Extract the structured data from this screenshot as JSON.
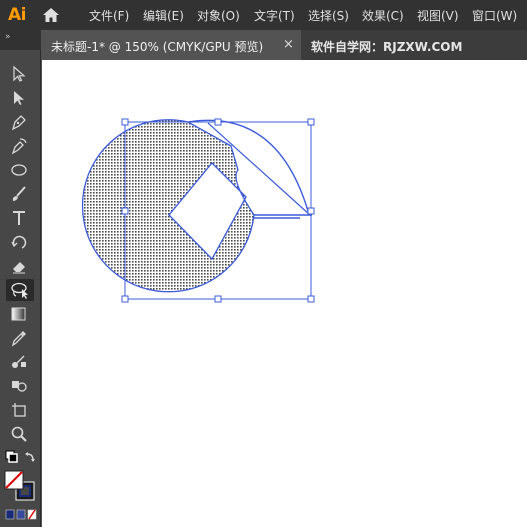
{
  "app": {
    "logo": "Ai"
  },
  "menu": [
    {
      "id": "file",
      "label": "文件(F)"
    },
    {
      "id": "edit",
      "label": "编辑(E)"
    },
    {
      "id": "object",
      "label": "对象(O)"
    },
    {
      "id": "type",
      "label": "文字(T)"
    },
    {
      "id": "select",
      "label": "选择(S)"
    },
    {
      "id": "effect",
      "label": "效果(C)"
    },
    {
      "id": "view",
      "label": "视图(V)"
    },
    {
      "id": "window",
      "label": "窗口(W)"
    }
  ],
  "tabs": {
    "active_title": "未标题-1* @ 150% (CMYK/GPU 预览)",
    "close_symbol": "×",
    "inactive_title": "软件自学网：RJZXW.COM"
  },
  "toolbar": {
    "collapse": "»",
    "tools": [
      "selection-tool",
      "direct-selection-tool",
      "pen-tool",
      "curvature-tool",
      "ellipse-tool",
      "paintbrush-tool",
      "type-tool",
      "rotate-tool",
      "eraser-tool",
      "lasso-tool",
      "gradient-tool",
      "eyedropper-tool",
      "blend-tool",
      "shape-builder-tool",
      "artboard-tool",
      "zoom-tool"
    ],
    "active_tool": "lasso-tool"
  },
  "colors": {
    "selection": "#3b5bdb",
    "fill_pattern": "#4a4a4a",
    "menubar": "#323232",
    "toolbar": "#474747"
  }
}
